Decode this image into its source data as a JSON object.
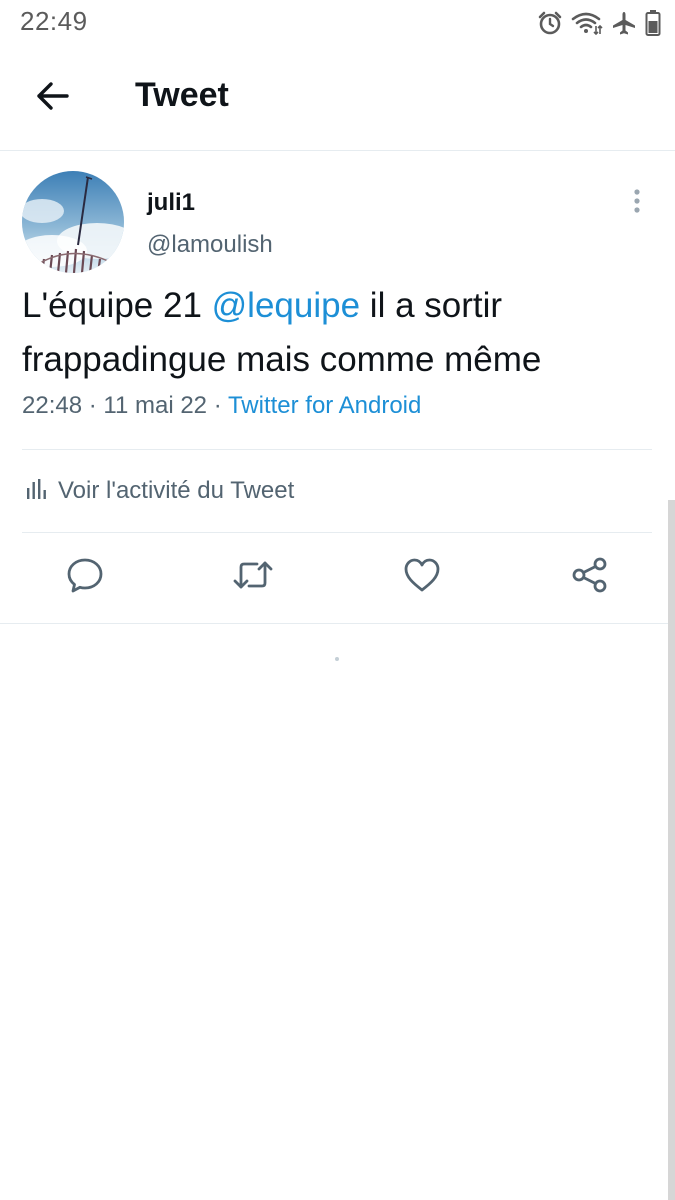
{
  "status_bar": {
    "time": "22:49",
    "icons": [
      "alarm-icon",
      "wifi-icon",
      "airplane-icon",
      "battery-icon"
    ]
  },
  "app_bar": {
    "back_icon": "arrow-left-icon",
    "title": "Tweet"
  },
  "tweet": {
    "display_name": "juli1",
    "handle": "@lamoulish",
    "text_before": "L'équipe 21 ",
    "mention": "@lequipe",
    "text_after": " il a sortir frappadingue mais comme même",
    "time": "22:48",
    "separator": "·",
    "date": "11 mai 22",
    "source": "Twitter for Android",
    "activity_label": "Voir l'activité du Tweet",
    "actions": [
      "reply-icon",
      "retweet-icon",
      "like-icon",
      "share-icon"
    ]
  },
  "colors": {
    "accent": "#1d8fd6",
    "secondary_text": "#536471",
    "primary_text": "#0f1419",
    "divider": "#e6ecf0"
  }
}
